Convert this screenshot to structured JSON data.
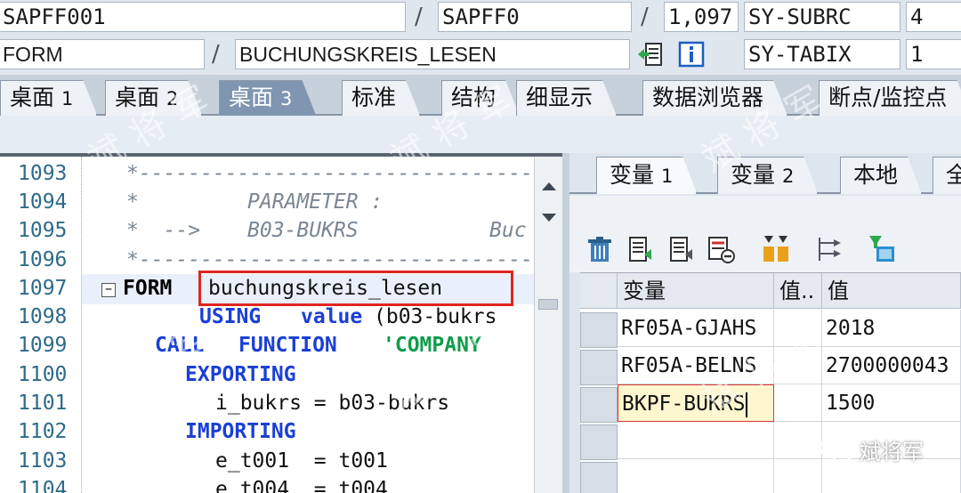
{
  "header": {
    "program": "SAPFF001",
    "include": "SAPFF0",
    "line": "1,097",
    "sy_subrc_label": "SY-SUBRC",
    "sy_subrc_value": "4",
    "event_type": "FORM",
    "event_name": "BUCHUNGSKREIS_LESEN",
    "sy_tabix_label": "SY-TABIX",
    "sy_tabix_value": "1",
    "slash": "/"
  },
  "tabs": [
    {
      "label": "桌面",
      "num": "1"
    },
    {
      "label": "桌面",
      "num": "2"
    },
    {
      "label": "桌面",
      "num": "3"
    },
    {
      "label": "标准",
      "num": ""
    },
    {
      "label": "结构",
      "num": ""
    },
    {
      "label": "细显示",
      "num": ""
    },
    {
      "label": "数据浏览器",
      "num": ""
    },
    {
      "label": "断点/监控点",
      "num": ""
    }
  ],
  "editor": {
    "line_numbers": [
      "1093",
      "1094",
      "1095",
      "1096",
      "1097",
      "1098",
      "1099",
      "1100",
      "1101",
      "1102",
      "1103",
      "1104"
    ],
    "lines": {
      "l1093": "*---------------------------------",
      "l1094_a": "*",
      "l1094_b": "PARAMETER :",
      "l1095_a": "*  -->",
      "l1095_b": "B03-BUKRS",
      "l1095_c": "Buc",
      "l1096": "*---------------------------------",
      "l1097_kw": "FORM",
      "l1097_name": "buchungskreis_lesen",
      "l1098_kw1": "USING",
      "l1098_kw2": "value",
      "l1098_rest": "(b03-bukrs",
      "l1099_kw1": "CALL",
      "l1099_kw2": "FUNCTION",
      "l1099_str": "'COMPANY",
      "l1100_kw": "EXPORTING",
      "l1101": "i_bukrs = b03-bukrs",
      "l1102_kw": "IMPORTING",
      "l1103": "e_t001  = t001",
      "l1104": "e_t004  = t004"
    },
    "fold_symbol": "−"
  },
  "right": {
    "tabs": [
      {
        "label": "变量",
        "num": "1"
      },
      {
        "label": "变量",
        "num": "2"
      },
      {
        "label": "本地",
        "num": ""
      },
      {
        "label": "全",
        "num": ""
      }
    ],
    "grid": {
      "headers": [
        "变量",
        "值..",
        "值"
      ],
      "rows": [
        {
          "var": "RF05A-GJAHS",
          "val": "2018"
        },
        {
          "var": "RF05A-BELNS",
          "val": "2700000043"
        },
        {
          "var": "BKPF-BUKRS",
          "val": "1500"
        }
      ]
    }
  },
  "watermark": {
    "text": "斌将军",
    "footer": "斌将军"
  },
  "colors": {
    "accent_tab": "#7f95b0",
    "keyword": "#1a3fd6",
    "string": "#0d9d4a",
    "highlight": "#e0261f"
  }
}
